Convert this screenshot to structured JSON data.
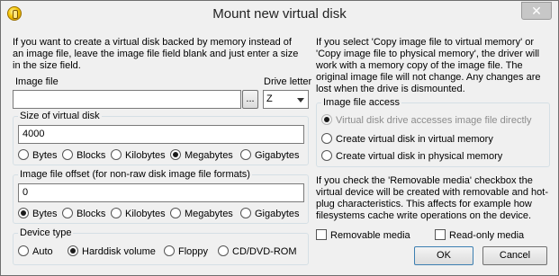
{
  "window": {
    "title": "Mount new virtual disk",
    "close_glyph": "✕"
  },
  "left": {
    "intro": "If you want to create a virtual disk backed by memory instead of an image file, leave the image file field blank and just enter a size in the size field.",
    "image_file_label": "Image file",
    "image_file_value": "",
    "browse_label": "...",
    "drive_letter_label": "Drive letter",
    "drive_letter_value": "Z",
    "size_group": {
      "label": "Size of virtual disk",
      "value": "4000",
      "units": [
        "Bytes",
        "Blocks",
        "Kilobytes",
        "Megabytes",
        "Gigabytes"
      ],
      "selected": "Megabytes"
    },
    "offset_group": {
      "label": "Image file offset (for non-raw disk image file formats)",
      "value": "0",
      "units": [
        "Bytes",
        "Blocks",
        "Kilobytes",
        "Megabytes",
        "Gigabytes"
      ],
      "selected": "Bytes"
    },
    "device_group": {
      "label": "Device type",
      "options": [
        "Auto",
        "Harddisk volume",
        "Floppy",
        "CD/DVD-ROM"
      ],
      "selected": "Harddisk volume"
    }
  },
  "right": {
    "copy_note": "If you select 'Copy image file to virtual memory' or 'Copy image file to physical memory', the driver will work with a memory copy of the image file. The original image file will not change. Any changes are lost when the drive is dismounted.",
    "access_group": {
      "label": "Image file access",
      "options": [
        "Virtual disk drive accesses image file directly",
        "Create virtual disk in virtual memory",
        "Create virtual disk in physical memory"
      ],
      "selected": "Virtual disk drive accesses image file directly"
    },
    "removable_note": "If you check the 'Removable media' checkbox the virtual device will be created with removable and hot-plug characteristics. This affects for example how filesystems cache write operations on the device.",
    "removable_label": "Removable media",
    "removable_checked": false,
    "readonly_label": "Read-only media",
    "readonly_checked": false,
    "ok_label": "OK",
    "cancel_label": "Cancel"
  }
}
